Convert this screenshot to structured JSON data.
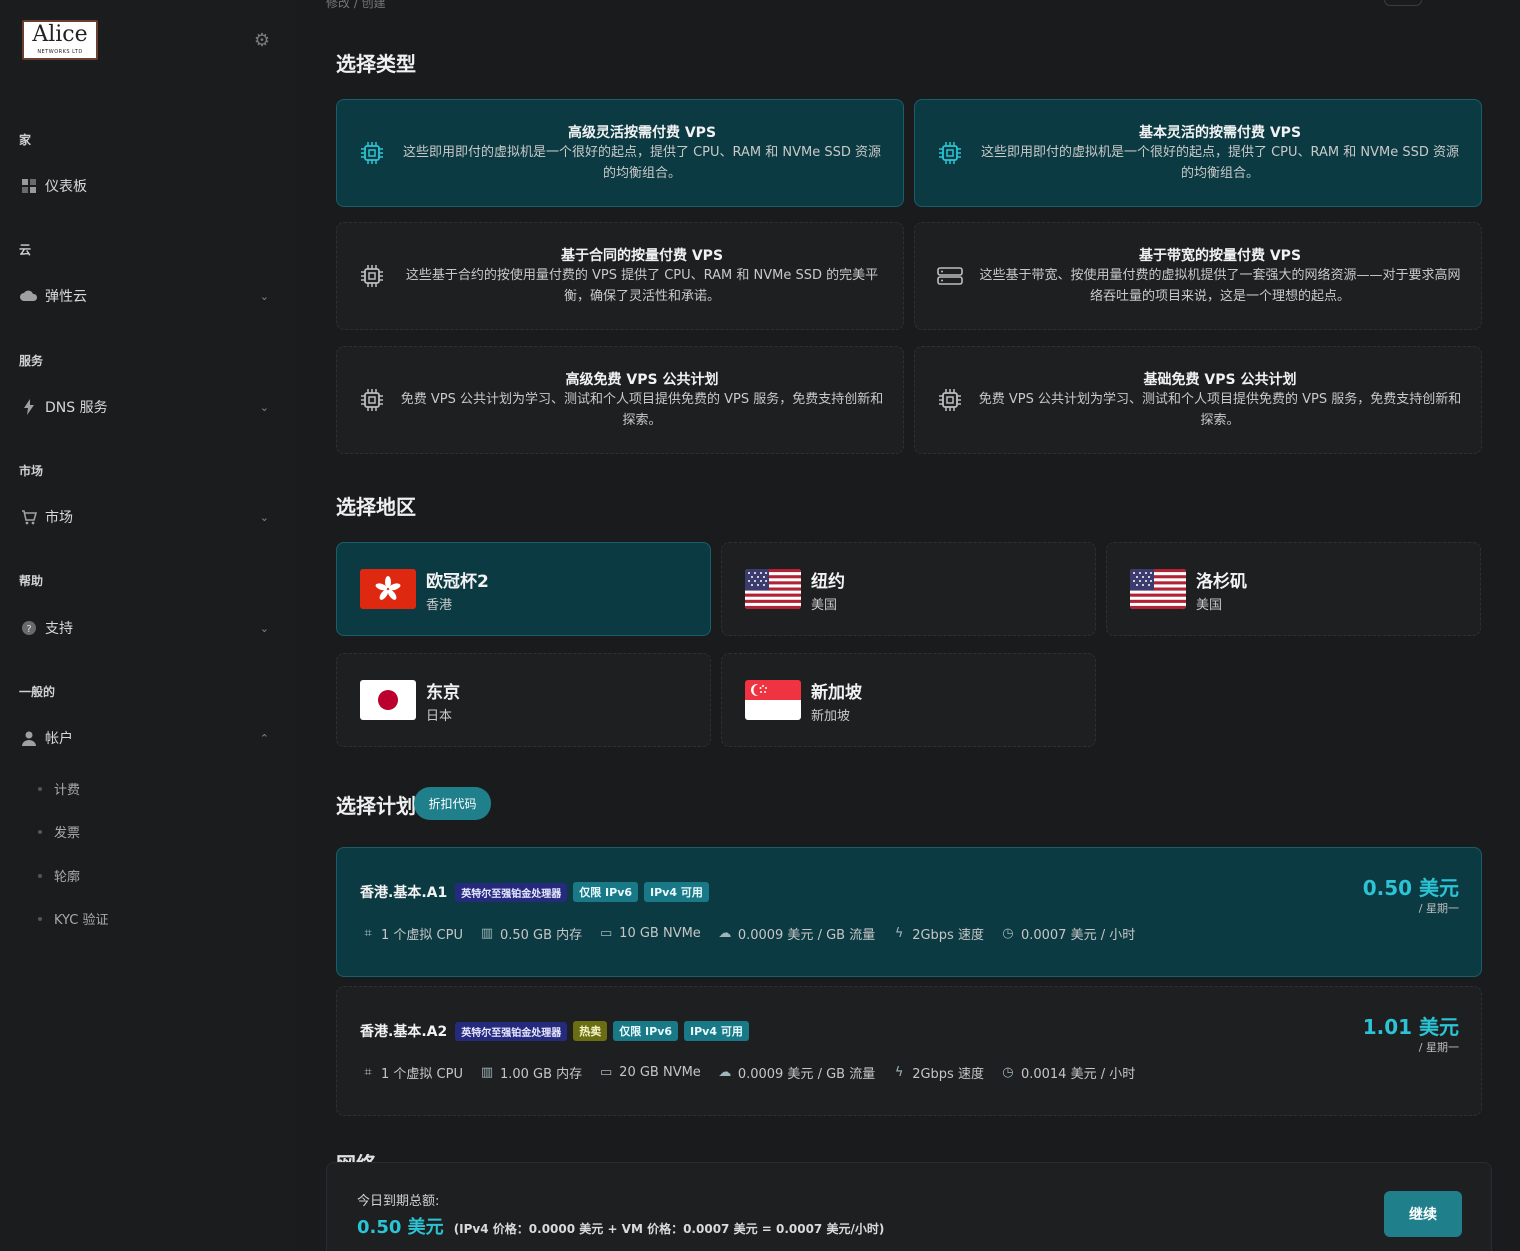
{
  "colors": {
    "accent": "#2cc4d4",
    "active_bg": "#0b3a42",
    "button": "#1f7f8a"
  },
  "sidebar": {
    "logo": {
      "name": "Alice",
      "sub": "NETWORKS LTD"
    },
    "sections": [
      {
        "title": "家",
        "item": "仪表板",
        "icon": "dashboard-icon"
      },
      {
        "title": "云",
        "item": "弹性云",
        "icon": "cloud-icon"
      },
      {
        "title": "服务",
        "item": "DNS 服务",
        "icon": "lightning-icon"
      },
      {
        "title": "市场",
        "item": "市场",
        "icon": "cart-icon"
      },
      {
        "title": "帮助",
        "item": "支持",
        "icon": "help-icon"
      },
      {
        "title": "一般的",
        "item": "帐户",
        "icon": "user-icon"
      }
    ],
    "account_sub": [
      "计费",
      "发票",
      "轮廓",
      "KYC 验证"
    ]
  },
  "top": {
    "fade_text": "修改 / 创建"
  },
  "types": {
    "heading": "选择类型",
    "cards": [
      {
        "title": "高级灵活按需付费 VPS",
        "desc": "这些即用即付的虚拟机是一个很好的起点，提供了 CPU、RAM 和 NVMe SSD 资源的均衡组合。",
        "icon": "chip-icon",
        "active": true
      },
      {
        "title": "基本灵活的按需付费 VPS",
        "desc": "这些即用即付的虚拟机是一个很好的起点，提供了 CPU、RAM 和 NVMe SSD 资源的均衡组合。",
        "icon": "chip-icon",
        "active": true
      },
      {
        "title": "基于合同的按量付费 VPS",
        "desc": "这些基于合约的按使用量付费的 VPS 提供了 CPU、RAM 和 NVMe SSD 的完美平衡，确保了灵活性和承诺。",
        "icon": "chip-icon",
        "active": false
      },
      {
        "title": "基于带宽的按量付费 VPS",
        "desc": "这些基于带宽、按使用量付费的虚拟机提供了一套强大的网络资源——对于要求高网络吞吐量的项目来说，这是一个理想的起点。",
        "icon": "server-icon",
        "active": false
      },
      {
        "title": "高级免费 VPS 公共计划",
        "desc": "免费 VPS 公共计划为学习、测试和个人项目提供免费的 VPS 服务，免费支持创新和探索。",
        "icon": "chip-icon",
        "active": false
      },
      {
        "title": "基础免费 VPS 公共计划",
        "desc": "免费 VPS 公共计划为学习、测试和个人项目提供免费的 VPS 服务，免费支持创新和探索。",
        "icon": "chip-icon",
        "active": false
      }
    ]
  },
  "regions": {
    "heading": "选择地区",
    "cards": [
      {
        "name": "欧冠杯2",
        "country": "香港",
        "flag": "hk-flag-icon",
        "active": true
      },
      {
        "name": "纽约",
        "country": "美国",
        "flag": "us-flag-icon",
        "active": false
      },
      {
        "name": "洛杉矶",
        "country": "美国",
        "flag": "us-flag-icon",
        "active": false
      },
      {
        "name": "东京",
        "country": "日本",
        "flag": "jp-flag-icon",
        "active": false
      },
      {
        "name": "新加坡",
        "country": "新加坡",
        "flag": "sg-flag-icon",
        "active": false
      }
    ]
  },
  "plans": {
    "heading": "选择计划",
    "discount": "折扣代码",
    "items": [
      {
        "name": "香港.基本.A1",
        "cpu_badge": "英特尔至强铂金处理器",
        "hot": "",
        "ipv6": "仅限 IPv6",
        "ipv4": "IPv4 可用",
        "specs": [
          "1 个虚拟 CPU",
          "0.50 GB 内存",
          "10 GB NVMe",
          "0.0009 美元 / GB 流量",
          "2Gbps 速度",
          "0.0007 美元 / 小时"
        ],
        "price": "0.50 美元",
        "period": "/ 星期一",
        "active": true
      },
      {
        "name": "香港.基本.A2",
        "cpu_badge": "英特尔至强铂金处理器",
        "hot": "热卖",
        "ipv6": "仅限 IPv6",
        "ipv4": "IPv4 可用",
        "specs": [
          "1 个虚拟 CPU",
          "1.00 GB 内存",
          "20 GB NVMe",
          "0.0009 美元 / GB 流量",
          "2Gbps 速度",
          "0.0014 美元 / 小时"
        ],
        "price": "1.01 美元",
        "period": "/ 星期一",
        "active": false
      }
    ],
    "spec_icons": [
      "chip-icon",
      "memory-icon",
      "disk-icon",
      "cloud-icon",
      "lightning-icon",
      "clock-icon"
    ]
  },
  "next_heading": "网络",
  "footer": {
    "label": "今日到期总额:",
    "amount": "0.50 美元",
    "detail": "(IPv4 价格：0.0000 美元 + VM 价格：0.0007 美元 = 0.0007 美元/小时)",
    "button": "继续"
  }
}
